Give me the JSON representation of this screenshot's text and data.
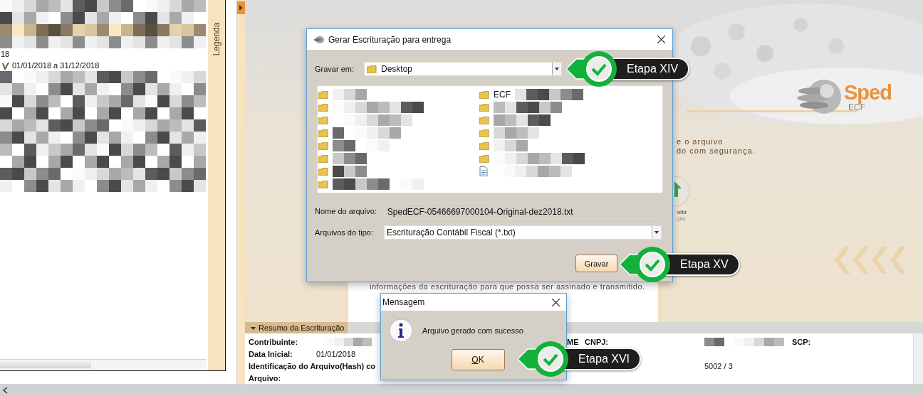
{
  "sidebar": {
    "date_fragment": "18",
    "period": "01/01/2018 a 31/12/2018",
    "legend_tab": "Legenda"
  },
  "background": {
    "logo": "Sped",
    "logo_sub": "ECF",
    "text_lines": [
      "e o arquivo",
      "do com segurança."
    ],
    "icon_caption": [
      "nitir",
      "ção"
    ],
    "panel_text": "informações da escrituração para que possa ser assinado e transmitido."
  },
  "summary": {
    "title": "Resumo da Escrituração",
    "expanded": true,
    "contribuinte_label": "Contribuinte:",
    "contribuinte_suffix": "ME",
    "cnpj_label": "CNPJ:",
    "scp_label": "SCP:",
    "data_inicial_label": "Data Inicial:",
    "data_inicial": "01/01/2018",
    "hash_label": "Identificação do Arquivo(Hash) co",
    "descritor_value": "5002 / 3",
    "arquivo_label": "Arquivo:"
  },
  "save_dialog": {
    "title": "Gerar Escrituração para entrega",
    "save_in_label": "Gravar em:",
    "save_in": "Desktop",
    "files_left": [
      {
        "kind": "folder"
      },
      {
        "kind": "folder"
      },
      {
        "kind": "folder"
      },
      {
        "kind": "folder"
      },
      {
        "kind": "folder"
      },
      {
        "kind": "folder"
      },
      {
        "kind": "folder"
      },
      {
        "kind": "folder"
      }
    ],
    "files_right": [
      {
        "kind": "folder",
        "name": "ECF"
      },
      {
        "kind": "folder"
      },
      {
        "kind": "folder"
      },
      {
        "kind": "folder"
      },
      {
        "kind": "folder"
      },
      {
        "kind": "folder"
      },
      {
        "kind": "file"
      }
    ],
    "filename_label": "Nome do arquivo:",
    "filename": "SpedECF-05466697000104-Original-dez2018.txt",
    "filetype_label": "Arquivos do tipo:",
    "filetype": "Escrituração Contábil Fiscal (*.txt)",
    "save_button": "Gravar"
  },
  "message_dialog": {
    "title": "Mensagem",
    "message": "Arquivo gerado com sucesso",
    "ok_button": "OK"
  },
  "callouts": [
    {
      "label": "Etapa XIV"
    },
    {
      "label": "Etapa XV"
    },
    {
      "label": "Etapa XVI"
    }
  ]
}
